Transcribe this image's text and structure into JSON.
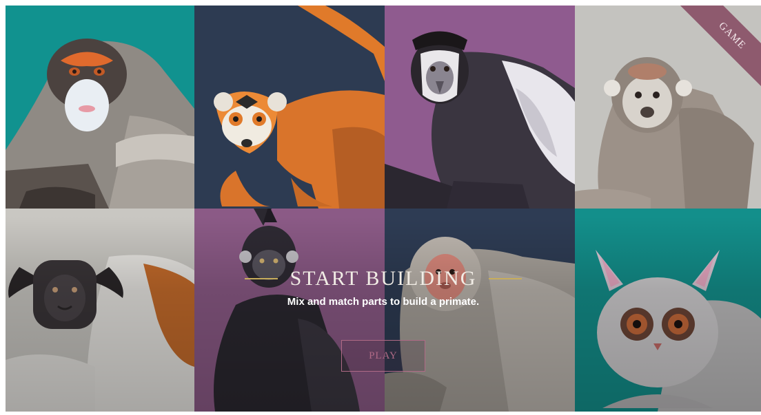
{
  "badge": {
    "label": "GAME",
    "color": "#8e5a6e"
  },
  "hero": {
    "title": "START BUILDING",
    "subtitle": "Mix and match parts to build a primate.",
    "play_label": "PLAY",
    "accent_rule_color": "#c8ad5c",
    "button_color": "#b06a86"
  },
  "tiles": [
    {
      "animal": "de-brazza-monkey",
      "bg": "#11928f"
    },
    {
      "animal": "crowned-lemur",
      "bg": "#2d3b52"
    },
    {
      "animal": "colobus-monkey",
      "bg": "#8f5b8f"
    },
    {
      "animal": "squirrel-monkey",
      "bg": "#c4c3bf"
    },
    {
      "animal": "tamarin",
      "bg": "#c9c7c2"
    },
    {
      "animal": "langur",
      "bg": "#8b5a86"
    },
    {
      "animal": "macaque",
      "bg": "#2e3c54"
    },
    {
      "animal": "bushbaby",
      "bg": "#138f8b"
    }
  ]
}
